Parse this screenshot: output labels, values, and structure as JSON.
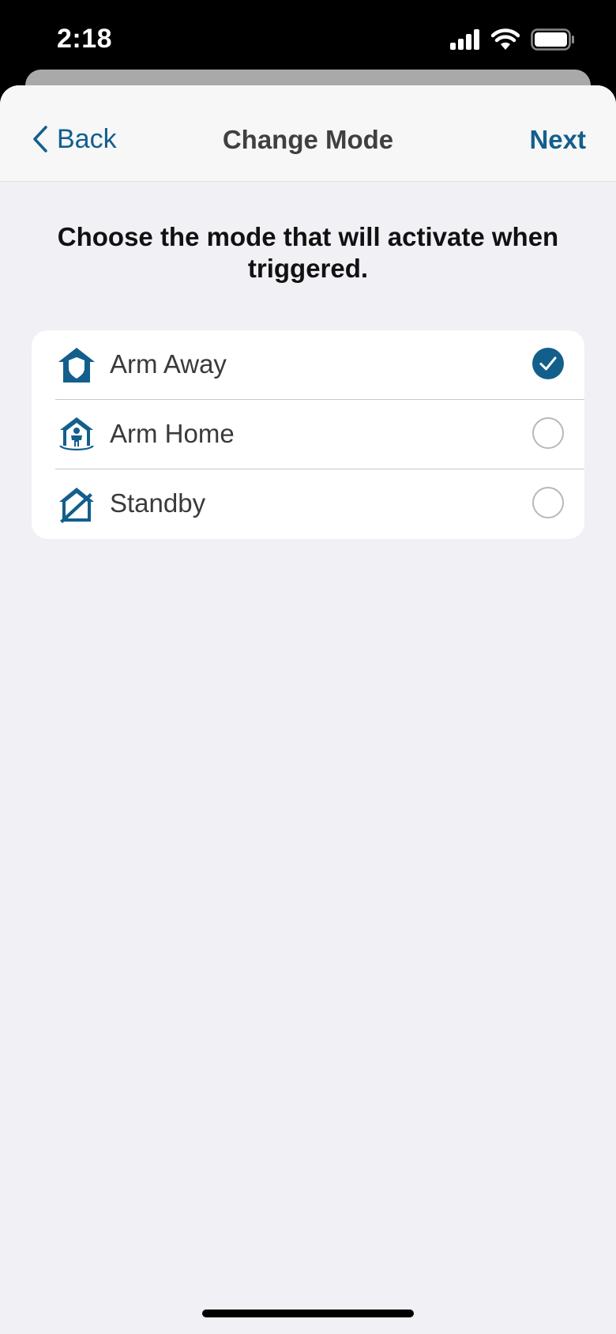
{
  "status_bar": {
    "time": "2:18"
  },
  "nav": {
    "back_label": "Back",
    "title": "Change Mode",
    "next_label": "Next"
  },
  "prompt": "Choose the mode that will activate when triggered.",
  "accent_color": "#135f8c",
  "modes": [
    {
      "label": "Arm Away",
      "icon": "arm-away-icon",
      "selected": true
    },
    {
      "label": "Arm Home",
      "icon": "arm-home-icon",
      "selected": false
    },
    {
      "label": "Standby",
      "icon": "standby-icon",
      "selected": false
    }
  ]
}
